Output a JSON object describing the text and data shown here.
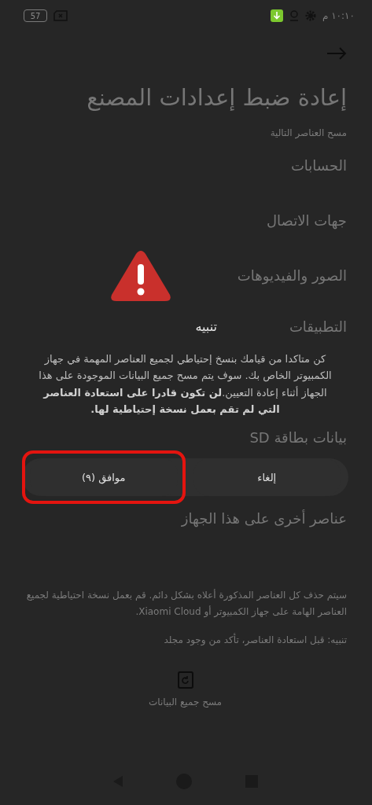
{
  "status_bar": {
    "time": "١٠:١٠ م",
    "battery": "57"
  },
  "header": {
    "title": "إعادة ضبط إعدادات المصنع",
    "subtitle": "مسح العناصر التالية"
  },
  "items": [
    {
      "label": "الحسابات"
    },
    {
      "label": "جهات الاتصال"
    },
    {
      "label": "الصور والفيديوهات"
    },
    {
      "label": "التطبيقات"
    },
    {
      "label": "بيانات بطاقة SD"
    },
    {
      "label": "عناصر أخرى على هذا الجهاز"
    }
  ],
  "notes": [
    "سيتم حذف كل العناصر المذكورة أعلاه بشكل دائم. قم بعمل نسخة احتياطية لجميع العناصر الهامة على جهاز الكمبيوتر أو Xiaomi Cloud.",
    "تنبيه: قبل استعادة العناصر، تأكد من وجود مجلد"
  ],
  "erase_button": {
    "label": "مسح جميع البيانات"
  },
  "dialog": {
    "title": "تنبيه",
    "message": "كن متاكدا من قيامك بنسخ إحتياطي لجميع العناصر المهمة في جهاز الكمبيوتر الخاص بك. سوف يتم مسح جميع البيانات الموجودة على هذا الجهاز أثناء إعادة التعيين.**لن تكون قادرا على استعادة العناصر التي لم تقم بعمل نسخة إحتياطية لها.**",
    "buttons": [
      {
        "label": "إلغاء",
        "highlighted": false
      },
      {
        "label": "موافق (٩)",
        "highlighted": true
      }
    ]
  }
}
